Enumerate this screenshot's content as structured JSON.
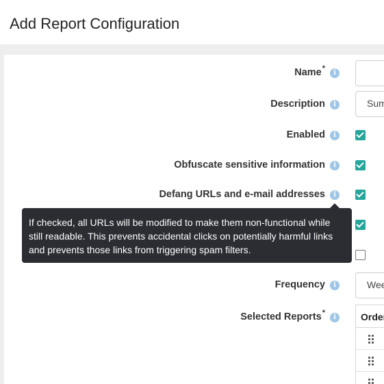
{
  "page": {
    "title": "Add Report Configuration"
  },
  "form": {
    "name": {
      "label": "Name",
      "required_mark": "*",
      "value": ""
    },
    "description": {
      "label": "Description",
      "value": "Sum"
    },
    "enabled": {
      "label": "Enabled",
      "checked": true
    },
    "obfuscate": {
      "label": "Obfuscate sensitive information",
      "checked": true
    },
    "defang": {
      "label": "Defang URLs and e-mail addresses",
      "checked": true
    },
    "hidden_row_1": {
      "checked": true
    },
    "hidden_row_2": {
      "checked": false
    },
    "frequency": {
      "label": "Frequency",
      "value": "Wee"
    },
    "selected_reports": {
      "label": "Selected Reports",
      "required_mark": "*",
      "column_header": "Order"
    }
  },
  "icons": {
    "info": "info-icon",
    "drag": "drag-handle-icon"
  },
  "info_glyph": "i",
  "tooltip": {
    "text": "If checked, all URLs will be modified to make them non-functional while still readable. This prevents accidental clicks on potentially harmful links and prevents those links from triggering spam filters."
  },
  "colors": {
    "checkbox_checked": "#26a69a",
    "info_icon": "#9fc6e6",
    "tooltip_bg": "#2b2d33"
  }
}
